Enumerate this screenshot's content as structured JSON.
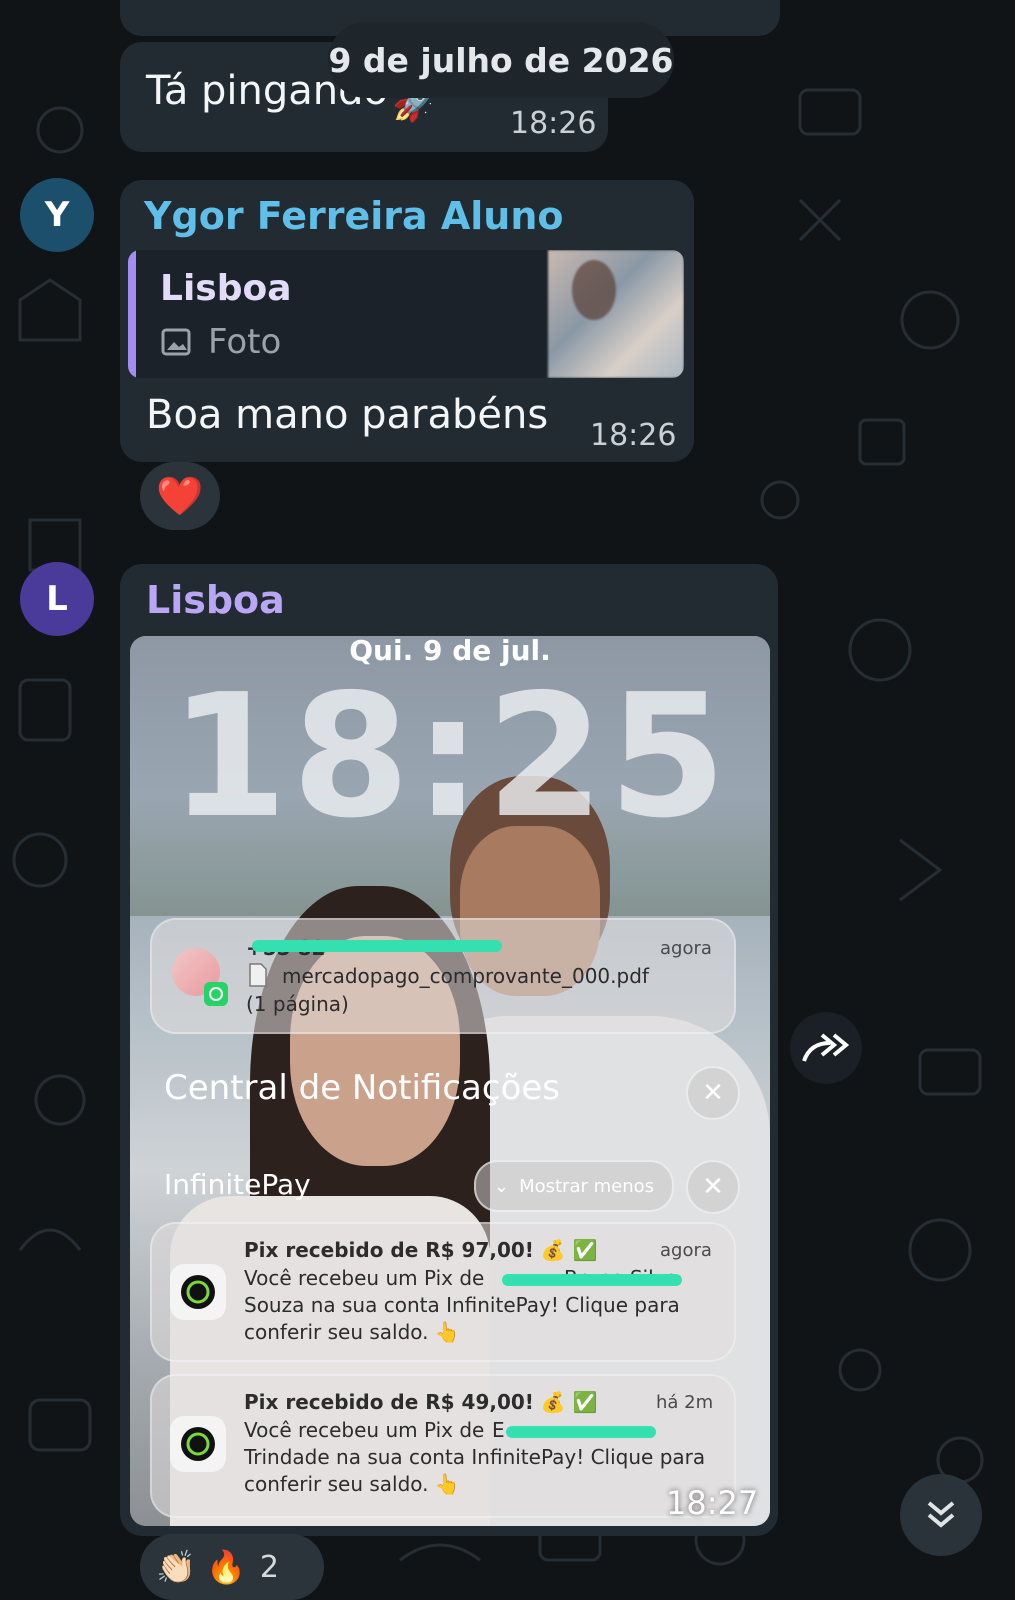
{
  "date_separator": "9 de julho de 2026",
  "messages": [
    {
      "text": "Tá pingando",
      "time": "18:26"
    },
    {
      "avatar_initial": "Y",
      "sender": "Ygor Ferreira Aluno",
      "reply": {
        "author": "Lisboa",
        "type": "Foto"
      },
      "text": "Boa mano parabéns",
      "time": "18:26",
      "reaction": "❤️"
    },
    {
      "avatar_initial": "L",
      "sender": "Lisboa",
      "time": "18:27",
      "reactions": {
        "emojis": "👏🏻 🔥",
        "count": "2"
      }
    }
  ],
  "lockscreen": {
    "date": "Qui. 9 de jul.",
    "clock": "18:25",
    "whatsapp_notification": {
      "sender": "+55 82",
      "time": "agora",
      "file": "mercadopago_comprovante_000.pdf",
      "pages": "(1 página)"
    },
    "center_title": "Central de Notificações",
    "app_group": "InfinitePay",
    "show_less": "Mostrar menos",
    "notifications": [
      {
        "title": "Pix recebido de R$ 97,00! 💰 ✅",
        "time": "agora",
        "line1": "Você recebeu um Pix de",
        "line1_visible_tail": "Bruno Silva",
        "line2": "Souza na sua conta InfinitePay! Clique para",
        "line3": "conferir seu saldo. 👆"
      },
      {
        "title": "Pix recebido de R$ 49,00! 💰 ✅",
        "time": "há 2m",
        "line1": "Você recebeu um Pix de",
        "line1_visible_tail": "E",
        "line2": "Trindade na sua conta InfinitePay! Clique para",
        "line3": "conferir seu saldo. 👆"
      }
    ]
  },
  "colors": {
    "background": "#101417",
    "bubble": "#222b32",
    "ygor_name": "#5fbfe8",
    "lisboa_name": "#b9a6f5",
    "reply_bar": "#a48df2",
    "y_avatar": "#1c4f6b",
    "l_avatar": "#4a3a9a"
  },
  "icons": {
    "forward": "forward-arrow-icon",
    "scroll_down": "double-chevron-down-icon",
    "photo": "image-icon",
    "close": "close-icon",
    "chevron": "chevron-down-icon"
  }
}
